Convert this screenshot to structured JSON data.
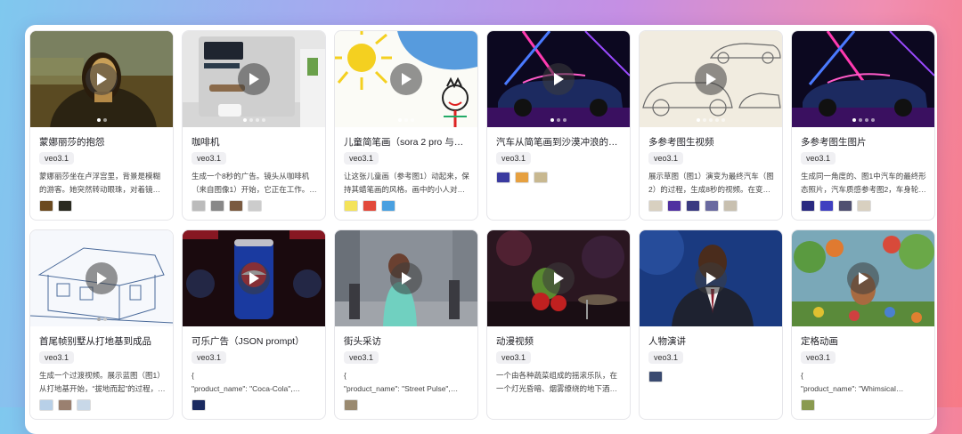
{
  "cards": [
    {
      "title": "蒙娜丽莎的抱怨",
      "tag": "veo3.1",
      "desc": "蒙娜丽莎坐在卢浮宫里，背景是模糊的游客。她突然转动眼珠，对着镜头小…",
      "refs": [
        "#6b4a20",
        "#2a2a20"
      ]
    },
    {
      "title": "咖啡机",
      "tag": "veo3.1",
      "desc": "生成一个8秒的广告。镜头从咖啡机（来自图像1）开始，它正在工作。然…",
      "refs": [
        "#bbbbbb",
        "#888888",
        "#7a5a40",
        "#cccccc"
      ]
    },
    {
      "title": "儿童简笔画（sora 2 pro 与…",
      "tag": "veo3.1",
      "desc": "让这张儿童画（参考图1）动起来，保持其蜡笔画的风格。画中的小人对着…",
      "refs": [
        "#f4e35a",
        "#e24a3b",
        "#4aa0e0"
      ]
    },
    {
      "title": "汽车从简笔画到沙漠冲浪的过程",
      "tag": "veo3.1",
      "desc": "",
      "refs": [
        "#3a3aa0",
        "#e6a040",
        "#c8b890"
      ]
    },
    {
      "title": "多参考图生视频",
      "tag": "veo3.1",
      "desc": "展示草图（图1）演变为最终汽车（图2）的过程，生成8秒的视频。在变…",
      "refs": [
        "#d8d0c0",
        "#5030a0",
        "#3a3a80",
        "#6a6aa0",
        "#c8c0b0"
      ]
    },
    {
      "title": "多参考图生图片",
      "tag": "veo3.1",
      "desc": "生成同一角度的、图1中汽车的最终形态照片，汽车质感参考图2，车身轮…",
      "refs": [
        "#2a2a80",
        "#4040c0",
        "#505070",
        "#d8d0c0"
      ]
    },
    {
      "title": "首尾帧别墅从打地基到成品",
      "tag": "veo3.1",
      "desc": "生成一个过渡视频。展示蓝图（图1）从打地基开始，“拔地而起”的过程，…",
      "refs": [
        "#b8d0e8",
        "#9a8070",
        "#c8d8e8"
      ]
    },
    {
      "title": "可乐广告（JSON prompt）",
      "tag": "veo3.1",
      "desc": "{\n\"product_name\": \"Coca-Cola\",…",
      "refs": [
        "#1a2a60"
      ]
    },
    {
      "title": "街头采访",
      "tag": "veo3.1",
      "desc": "{\n\"product_name\": \"Street Pulse\",…",
      "refs": [
        "#9a8a70"
      ]
    },
    {
      "title": "动漫视频",
      "tag": "veo3.1",
      "desc": "一个由各种蔬菜组成的摇滚乐队，在一个灯光昏暗、烟雾缭绕的地下酒吧里…",
      "refs": []
    },
    {
      "title": "人物演讲",
      "tag": "veo3.1",
      "desc": "",
      "refs": [
        "#3a4a70"
      ]
    },
    {
      "title": "定格动画",
      "tag": "veo3.1",
      "desc": "{\n\"product_name\": \"Whimsical…",
      "refs": [
        "#8a9a50"
      ]
    }
  ]
}
